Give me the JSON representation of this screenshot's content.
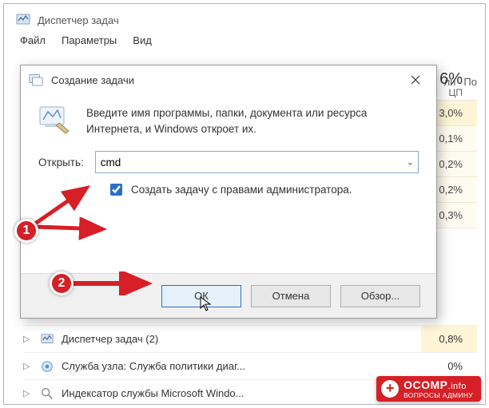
{
  "main_window": {
    "title": "Диспетчер задач",
    "menu": {
      "file": "Файл",
      "options": "Параметры",
      "view": "Вид"
    },
    "tabs_partial": [
      "ли",
      "По"
    ],
    "cpu_header": {
      "percent": "6%",
      "label": "ЦП"
    },
    "cpu_rows": [
      "3,0%",
      "0,1%",
      "0,2%",
      "0,2%",
      "0,3%"
    ],
    "processes": [
      {
        "name": "Диспетчер задач (2)",
        "cpu": "0,8%",
        "expandable": true
      },
      {
        "name": "Служба узла: Служба политики диаг...",
        "cpu": "0%",
        "expandable": true
      },
      {
        "name": "Индексатор службы Microsoft Windo...",
        "cpu": "",
        "expandable": true
      }
    ]
  },
  "dialog": {
    "title": "Создание задачи",
    "instruction": "Введите имя программы, папки, документа или ресурса Интернета, и Windows откроет их.",
    "open_label": "Открыть:",
    "open_value": "cmd",
    "admin_checkbox_label": "Создать задачу с правами администратора.",
    "admin_checked": true,
    "buttons": {
      "ok": "ОК",
      "cancel": "Отмена",
      "browse": "Обзор..."
    }
  },
  "annotations": {
    "step1": "1",
    "step2": "2"
  },
  "watermark": {
    "brand_main": "OCOMP",
    "brand_suffix": ".info",
    "tagline": "ВОПРОСЫ АДМИНУ"
  }
}
